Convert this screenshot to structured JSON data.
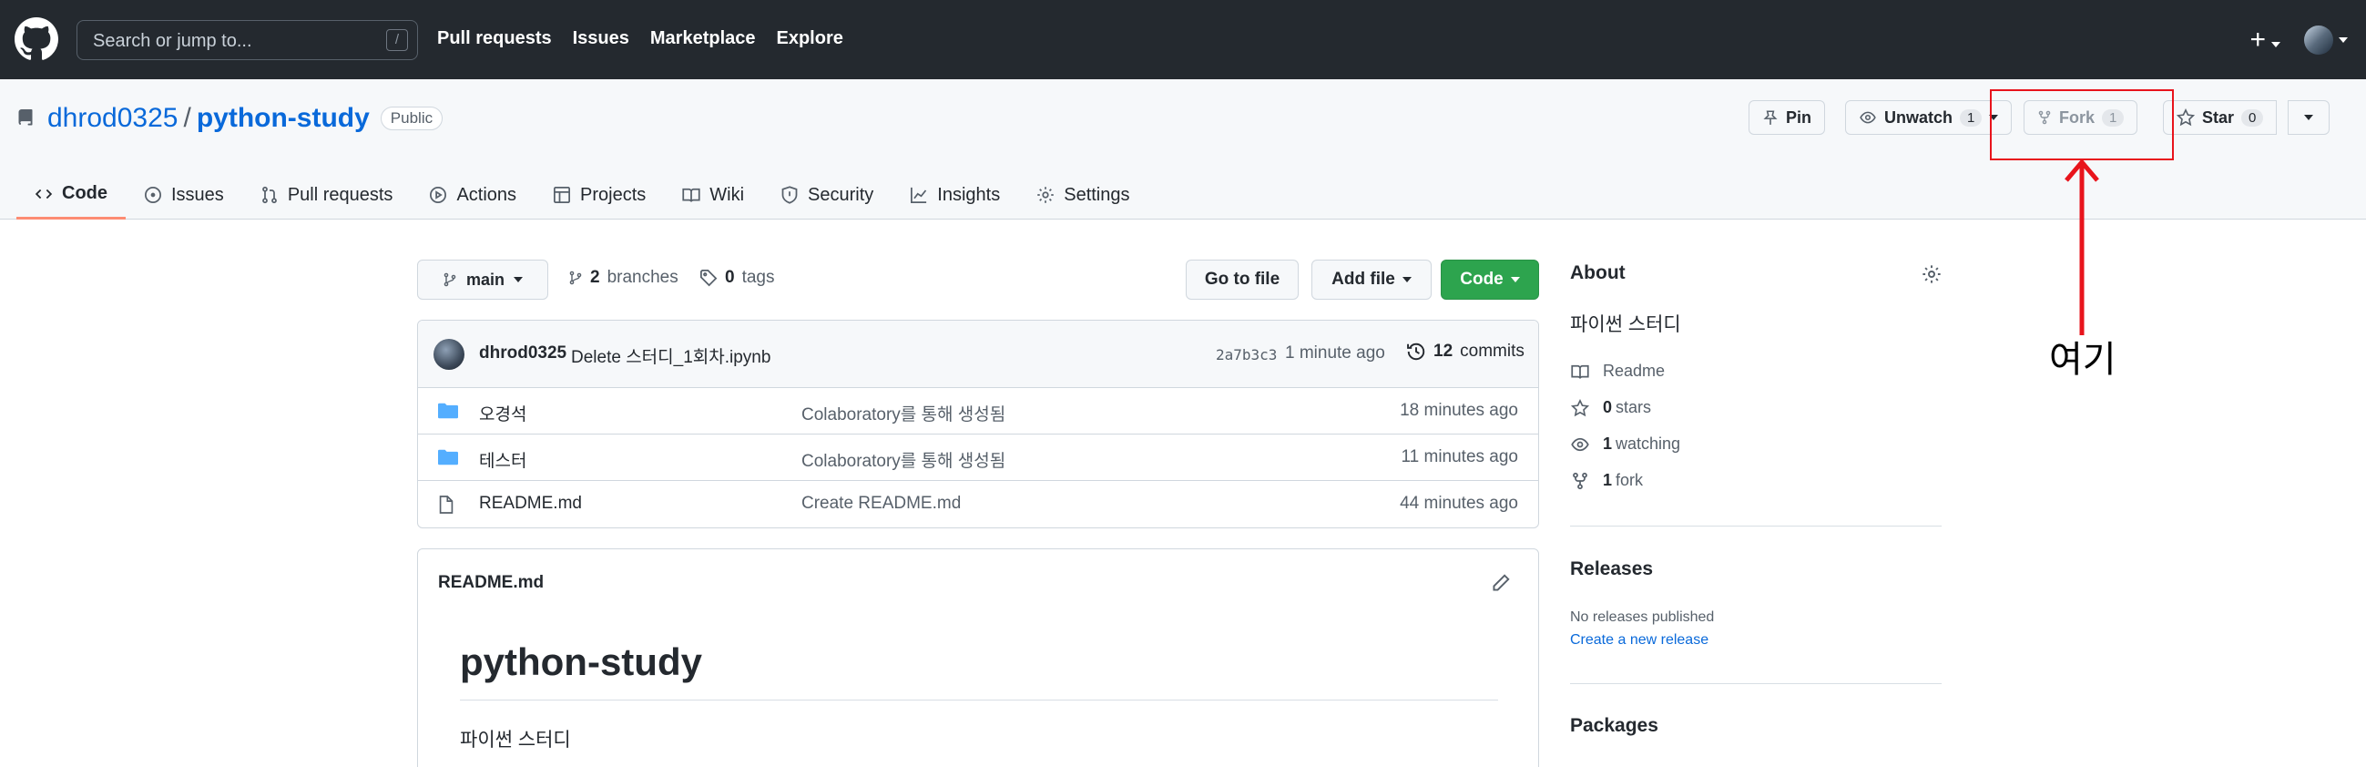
{
  "header": {
    "search_placeholder": "Search or jump to...",
    "search_shortcut": "/",
    "nav": [
      "Pull requests",
      "Issues",
      "Marketplace",
      "Explore"
    ],
    "new_label": "+"
  },
  "repo": {
    "owner": "dhrod0325",
    "separator": "/",
    "name": "python-study",
    "visibility": "Public",
    "actions": {
      "pin": "Pin",
      "unwatch": "Unwatch",
      "watch_count": "1",
      "fork": "Fork",
      "fork_count": "1",
      "star": "Star",
      "star_count": "0"
    },
    "tabs": [
      "Code",
      "Issues",
      "Pull requests",
      "Actions",
      "Projects",
      "Wiki",
      "Security",
      "Insights",
      "Settings"
    ]
  },
  "branchbar": {
    "branch": "main",
    "branches_count": "2",
    "branches_label": "branches",
    "tags_count": "0",
    "tags_label": "tags",
    "go_to_file": "Go to file",
    "add_file": "Add file",
    "code": "Code"
  },
  "commit": {
    "author": "dhrod0325",
    "message": "Delete 스터디_1회차.ipynb",
    "sha": "2a7b3c3",
    "time": "1 minute ago",
    "commits_count": "12",
    "commits_label": "commits"
  },
  "files": [
    {
      "name": "오경석",
      "message": "Colaboratory를 통해 생성됨",
      "time": "18 minutes ago",
      "type": "folder"
    },
    {
      "name": "테스터",
      "message": "Colaboratory를 통해 생성됨",
      "time": "11 minutes ago",
      "type": "folder"
    },
    {
      "name": "README.md",
      "message": "Create README.md",
      "time": "44 minutes ago",
      "type": "file"
    }
  ],
  "readme": {
    "filename": "README.md",
    "heading": "python-study",
    "body": "파이썬 스터디"
  },
  "about": {
    "title": "About",
    "description": "파이썬 스터디",
    "readme": "Readme",
    "stars_count": "0",
    "stars_label": "stars",
    "watching_count": "1",
    "watching_label": "watching",
    "forks_count": "1",
    "forks_label": "fork"
  },
  "releases": {
    "title": "Releases",
    "none_text": "No releases published",
    "create_link": "Create a new release"
  },
  "packages": {
    "title": "Packages"
  },
  "annotation": {
    "text": "여기",
    "color": "#e8141c"
  },
  "colors": {
    "header_bg": "#24292f",
    "link": "#0969da",
    "green": "#2da44e",
    "tab_underline": "#fd8c73"
  }
}
